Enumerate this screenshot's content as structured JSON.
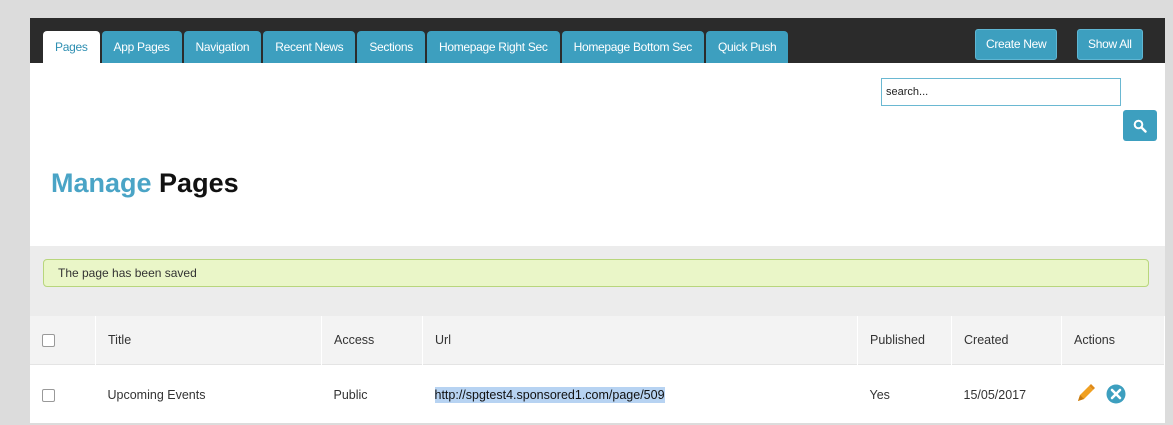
{
  "tabs": [
    {
      "label": "Pages",
      "active": true
    },
    {
      "label": "App Pages",
      "active": false
    },
    {
      "label": "Navigation",
      "active": false
    },
    {
      "label": "Recent News",
      "active": false
    },
    {
      "label": "Sections",
      "active": false
    },
    {
      "label": "Homepage Right Sec",
      "active": false
    },
    {
      "label": "Homepage Bottom Sec",
      "active": false
    },
    {
      "label": "Quick Push",
      "active": false
    }
  ],
  "toolbar": {
    "create_new_label": "Create New",
    "show_all_label": "Show All"
  },
  "search": {
    "placeholder": "search...",
    "icon": "search-icon"
  },
  "page_title": {
    "accent": "Manage",
    "rest": "Pages"
  },
  "alert": {
    "message": "The page has been saved"
  },
  "table": {
    "columns": {
      "title": "Title",
      "access": "Access",
      "url": "Url",
      "published": "Published",
      "created": "Created",
      "actions": "Actions"
    },
    "rows": [
      {
        "title": "Upcoming Events",
        "access": "Public",
        "url": "http://spgtest4.sponsored1.com/page/509",
        "published": "Yes",
        "created": "15/05/2017",
        "actions": [
          "pencil-icon",
          "delete-icon"
        ]
      }
    ]
  },
  "colors": {
    "accent": "#3d9fbf",
    "title_accent": "#4aa4c6",
    "tabbar_bg": "#2b2b2b",
    "alert_bg": "#eaf6c8",
    "edit_icon": "#f0a020"
  }
}
